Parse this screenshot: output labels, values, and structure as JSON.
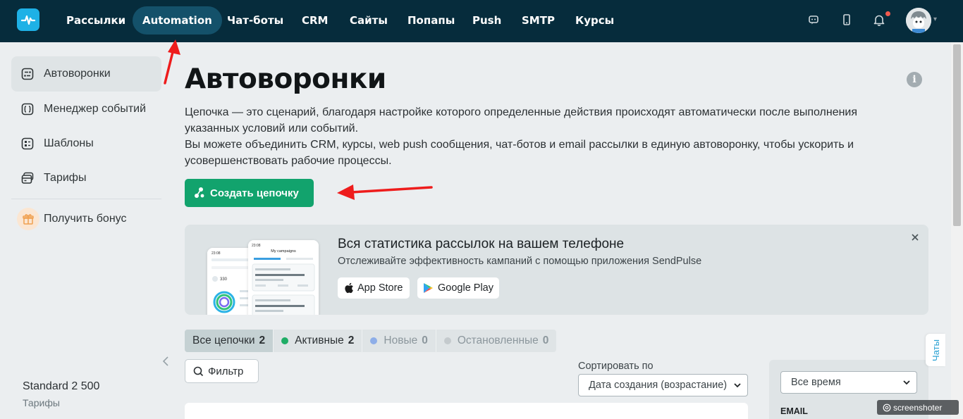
{
  "topnav": {
    "items": [
      {
        "label": "Рассылки"
      },
      {
        "label": "Automation"
      },
      {
        "label": "Чат-боты"
      },
      {
        "label": "CRM"
      },
      {
        "label": "Сайты"
      },
      {
        "label": "Попапы"
      },
      {
        "label": "Push"
      },
      {
        "label": "SMTP"
      },
      {
        "label": "Курсы"
      }
    ],
    "active": "Automation"
  },
  "sidebar": {
    "items": [
      {
        "label": "Автоворонки",
        "icon": "funnel-icon"
      },
      {
        "label": "Менеджер событий",
        "icon": "events-icon"
      },
      {
        "label": "Шаблоны",
        "icon": "templates-icon"
      },
      {
        "label": "Тарифы",
        "icon": "pricing-icon"
      }
    ],
    "bonus": "Получить бонус",
    "plan_name": "Standard 2 500",
    "plan_link": "Тарифы"
  },
  "main": {
    "title": "Автоворонки",
    "desc_line1": "Цепочка — это сценарий, благодаря настройке которого определенные действия происходят автоматически после выполнения указанных условий или событий.",
    "desc_line2": "Вы можете объединить CRM, курсы, web push сообщения, чат-ботов и email рассылки в единую автоворонку, чтобы ускорить и усовершенствовать рабочие процессы.",
    "create_button": "Создать цепочку"
  },
  "banner": {
    "title": "Вся статистика рассылок на вашем телефоне",
    "subtitle": "Отслеживайте эффективность кампаний с помощью приложения SendPulse",
    "app_store": "App Store",
    "google_play": "Google Play",
    "phone_header": "My campaigns",
    "phone_time": "23:08",
    "phone_stat": "330"
  },
  "tabs": [
    {
      "label": "Все цепочки",
      "count": "2",
      "dot": null
    },
    {
      "label": "Активные",
      "count": "2",
      "dot": "#1fad66"
    },
    {
      "label": "Новые",
      "count": "0",
      "dot": "#8eaee8"
    },
    {
      "label": "Остановленные",
      "count": "0",
      "dot": "#c4cacd"
    }
  ],
  "filter": {
    "label": "Фильтр"
  },
  "sort": {
    "label": "Сортировать по",
    "value": "Дата создания (возрастание)"
  },
  "period": {
    "value": "Все время"
  },
  "right_panel": {
    "email_label": "EMAIL"
  },
  "chats": "Чаты",
  "watermark": "screenshoter",
  "colors": {
    "nav_bg": "#062c3c",
    "accent_green": "#12a36d",
    "active_nav": "#14516a",
    "logo": "#1eb1e6"
  }
}
